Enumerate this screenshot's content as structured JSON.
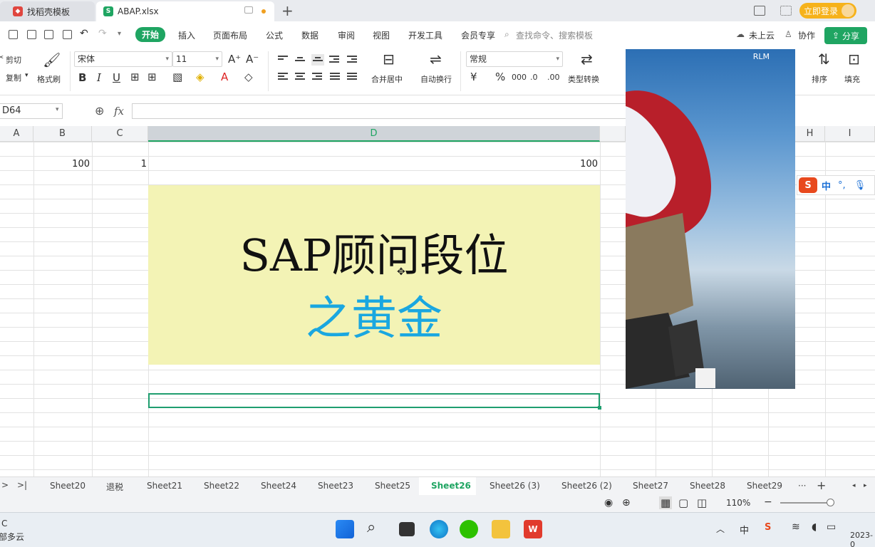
{
  "titlebar": {
    "tabs": [
      {
        "label": "找稻壳模板"
      },
      {
        "label": "ABAP.xlsx"
      }
    ],
    "login_label": "立即登录"
  },
  "menubar": {
    "items": [
      "开始",
      "插入",
      "页面布局",
      "公式",
      "数据",
      "审阅",
      "视图",
      "开发工具",
      "会员专享"
    ],
    "search_placeholder": "查找命令、搜索模板",
    "cloud_label": "未上云",
    "collab_label": "协作",
    "share_label": "分享"
  },
  "ribbon": {
    "cut": "剪切",
    "copy": "复制",
    "format_painter": "格式刷",
    "font_name": "宋体",
    "font_size": "11",
    "merge_center": "合并居中",
    "wrap_text": "自动换行",
    "number_format": "常规",
    "type_convert": "类型转换",
    "sort": "排序",
    "fill": "填充",
    "bold": "B",
    "italic": "I",
    "underline": "U"
  },
  "formula_bar": {
    "name_box": "D64",
    "fx": "fx"
  },
  "columns": [
    "A",
    "B",
    "C",
    "D",
    "H",
    "I"
  ],
  "cells": {
    "b_value": "100",
    "c_value": "1",
    "d_value": "100"
  },
  "banner": {
    "line1": "SAP顾问段位",
    "line2": "之黄金",
    "line2_color": "#1aa7e0",
    "background": "#f3f3b5"
  },
  "photo": {
    "label": "RLM"
  },
  "ime": {
    "mode": "中",
    "punct": "°,"
  },
  "sheets": [
    "Sheet20",
    "退税",
    "Sheet21",
    "Sheet22",
    "Sheet24",
    "Sheet23",
    "Sheet25",
    "Sheet26",
    "Sheet26 (3)",
    "Sheet26 (2)",
    "Sheet27",
    "Sheet28",
    "Sheet29"
  ],
  "active_sheet": "Sheet26",
  "statusbar": {
    "zoom": "110%"
  },
  "taskbar": {
    "weather_line1": "C",
    "weather_line2": "部多云",
    "ime": "中",
    "clock_date": "2023-0"
  },
  "colors": {
    "accent": "#1fa562",
    "login": "#f6b21b"
  }
}
